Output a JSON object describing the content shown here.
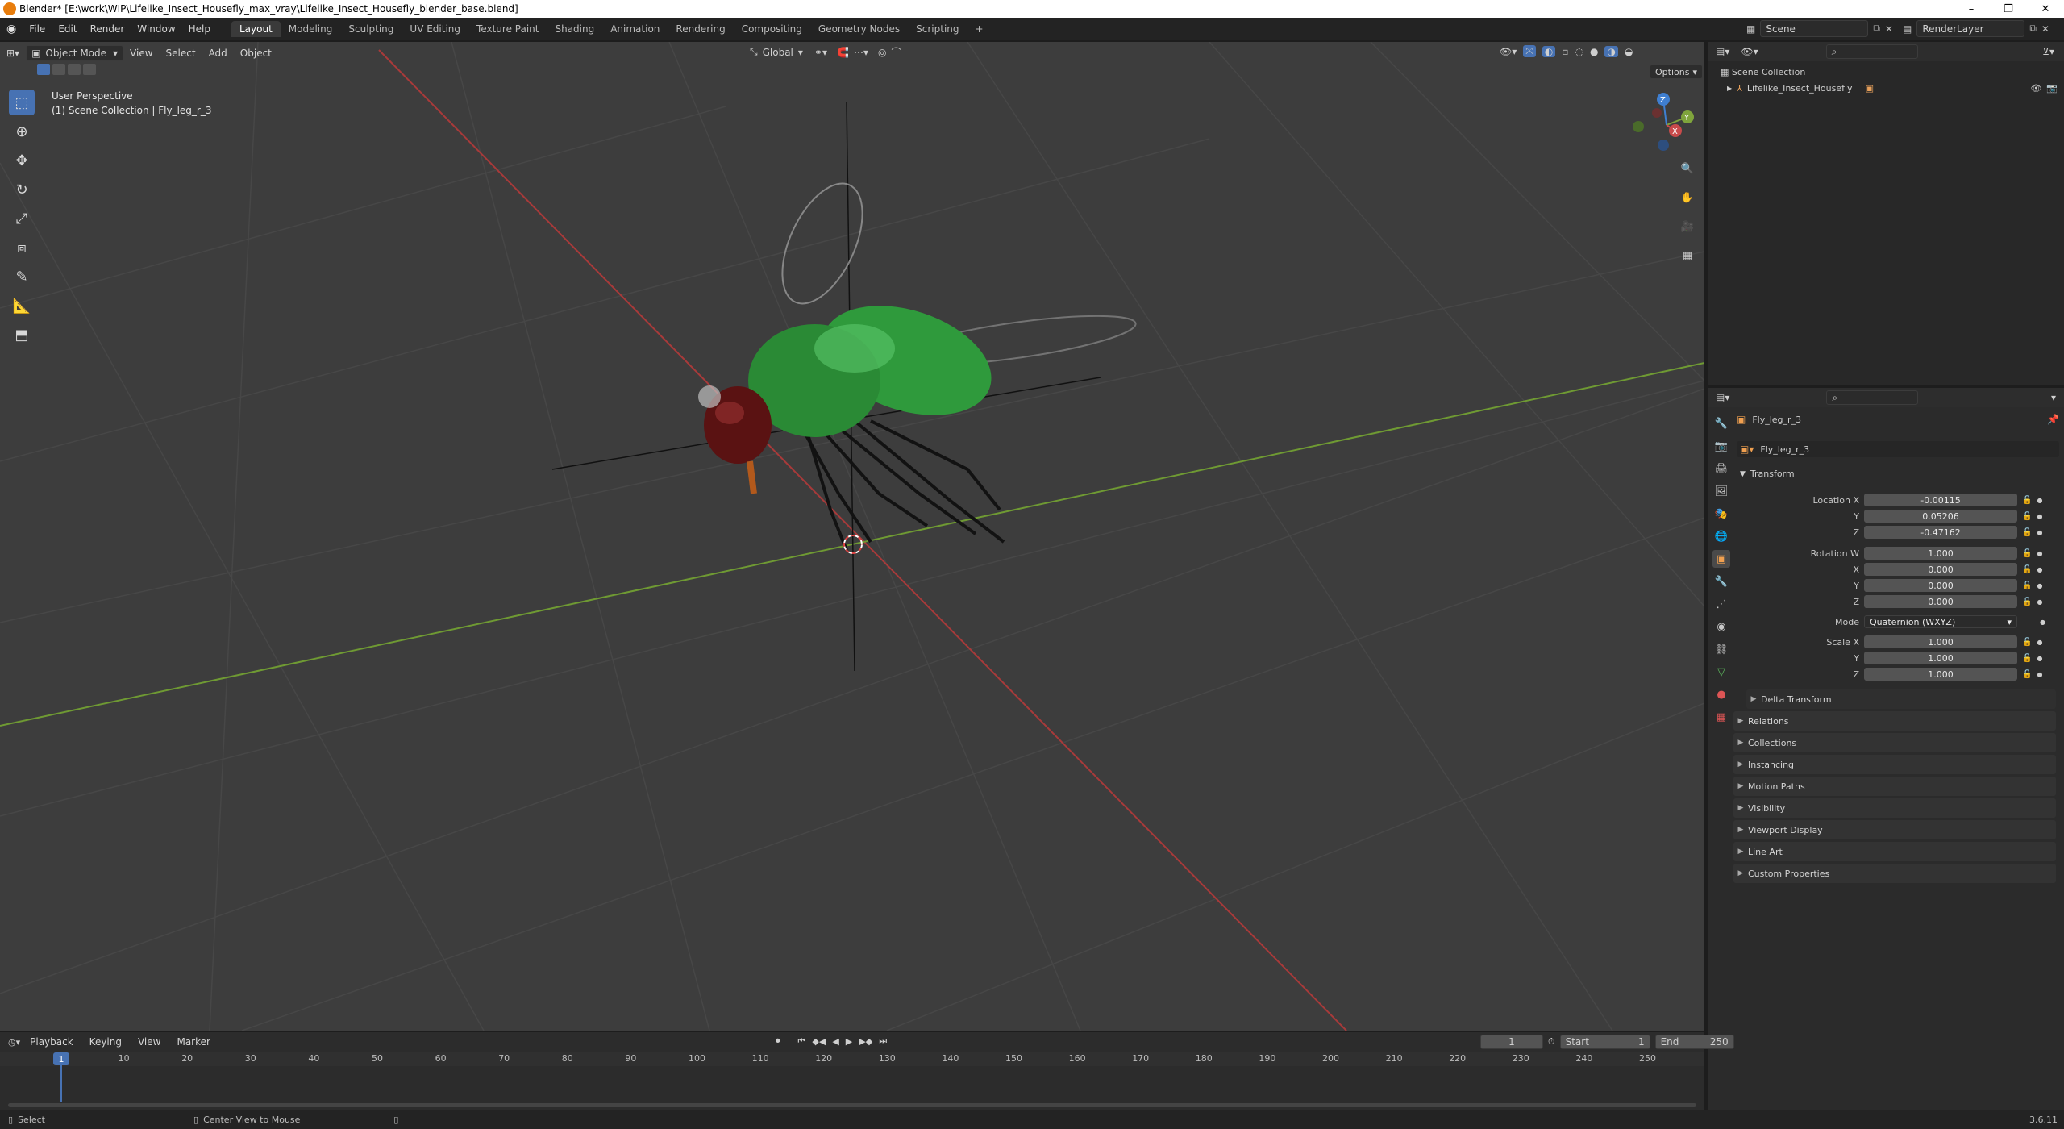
{
  "window": {
    "title": "Blender* [E:\\work\\WIP\\Lifelike_Insect_Housefly_max_vray\\Lifelike_Insect_Housefly_blender_base.blend]",
    "minimize": "–",
    "maximize": "❐",
    "close": "✕"
  },
  "menu": [
    "File",
    "Edit",
    "Render",
    "Window",
    "Help"
  ],
  "workspaces": [
    "Layout",
    "Modeling",
    "Sculpting",
    "UV Editing",
    "Texture Paint",
    "Shading",
    "Animation",
    "Rendering",
    "Compositing",
    "Geometry Nodes",
    "Scripting"
  ],
  "workspace_add": "+",
  "scene": {
    "name": "Scene",
    "renderlayer": "RenderLayer"
  },
  "viewport": {
    "mode": "Object Mode",
    "menus": [
      "View",
      "Select",
      "Add",
      "Object"
    ],
    "transform_orientation": "Global",
    "options_label": "Options",
    "overlay_title": "User Perspective",
    "overlay_subtitle": "(1) Scene Collection | Fly_leg_r_3",
    "gizmo_labels": {
      "x": "X",
      "y": "Y",
      "z": "Z"
    }
  },
  "outliner": {
    "root": "Scene Collection",
    "items": [
      {
        "label": "Lifelike_Insect_Housefly"
      }
    ]
  },
  "properties": {
    "object_name": "Fly_leg_r_3",
    "datablock_name": "Fly_leg_r_3",
    "transform_header": "Transform",
    "location": {
      "label": "Location X",
      "x": "-0.00115",
      "y": "0.05206",
      "z": "-0.47162"
    },
    "rotation": {
      "label": "Rotation W",
      "w": "1.000",
      "x": "0.000",
      "y": "0.000",
      "z": "0.000"
    },
    "mode": {
      "label": "Mode",
      "value": "Quaternion (WXYZ)"
    },
    "scale": {
      "label": "Scale X",
      "x": "1.000",
      "y": "1.000",
      "z": "1.000"
    },
    "axis_labels": {
      "y": "Y",
      "z": "Z",
      "x": "X"
    },
    "delta_transform": "Delta Transform",
    "panels": [
      "Relations",
      "Collections",
      "Instancing",
      "Motion Paths",
      "Visibility",
      "Viewport Display",
      "Line Art",
      "Custom Properties"
    ]
  },
  "timeline": {
    "menus": [
      "Playback",
      "Keying",
      "View",
      "Marker"
    ],
    "current_frame": "1",
    "start_label": "Start",
    "start": "1",
    "end_label": "End",
    "end": "250",
    "ticks": [
      "1",
      "10",
      "20",
      "30",
      "40",
      "50",
      "60",
      "70",
      "80",
      "90",
      "100",
      "110",
      "120",
      "130",
      "140",
      "150",
      "160",
      "170",
      "180",
      "190",
      "200",
      "210",
      "220",
      "230",
      "240",
      "250"
    ]
  },
  "status": {
    "select": "Select",
    "center": "Center View to Mouse",
    "version": "3.6.11"
  },
  "colors": {
    "accent": "#4772b3",
    "x_axis": "#c94b4b",
    "y_axis": "#7fa43c",
    "fly_green": "#2f9a3c"
  }
}
